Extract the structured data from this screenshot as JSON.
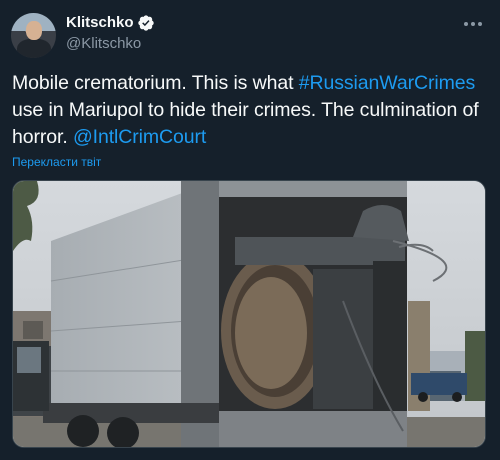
{
  "author": {
    "display_name": "Klitschko",
    "handle": "@Klitschko",
    "verified": true
  },
  "tweet": {
    "text_part1": "Mobile crematorium. This is what ",
    "hashtag": "#RussianWarCrimes",
    "text_part2": " use in Mariupol to hide their crimes. The culmination of horror. ",
    "mention": "@IntlCrimCourt"
  },
  "translate_label": "Перекласти твіт",
  "colors": {
    "background": "#15202b",
    "link": "#1d9bf0",
    "verified": "#1d9bf0",
    "secondary_text": "#8b98a5"
  },
  "icons": {
    "more": "more-icon",
    "verified": "verified-badge-icon"
  }
}
